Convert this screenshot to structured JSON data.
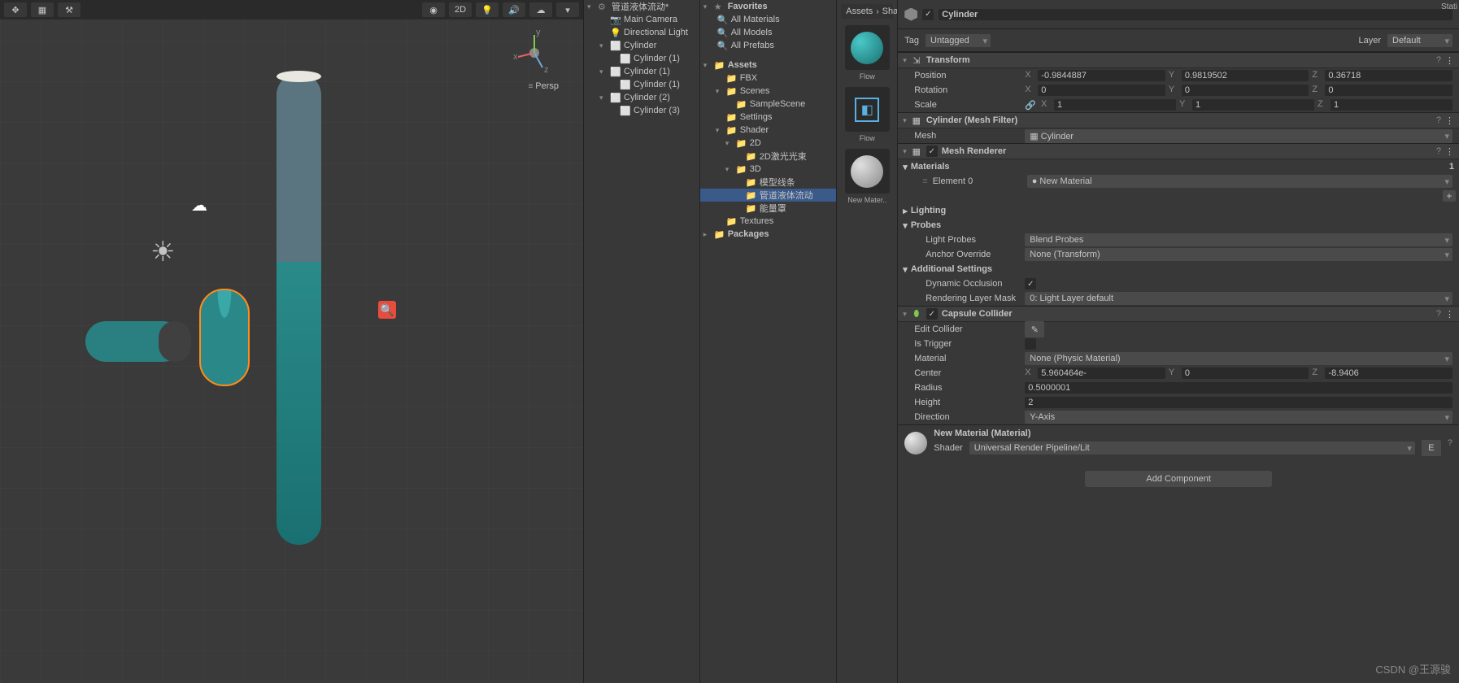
{
  "scene": {
    "persp": "Persp",
    "axes": {
      "x": "x",
      "y": "y",
      "z": "z"
    },
    "toolbar_2d": "2D"
  },
  "hierarchy": {
    "scene_name": "管道液体流动*",
    "items": [
      {
        "name": "Main Camera",
        "indent": 1,
        "icon": "📷"
      },
      {
        "name": "Directional Light",
        "indent": 1,
        "icon": "💡"
      },
      {
        "name": "Cylinder",
        "indent": 1,
        "icon": "⬜",
        "fold": "▾"
      },
      {
        "name": "Cylinder (1)",
        "indent": 2,
        "icon": "⬜"
      },
      {
        "name": "Cylinder (1)",
        "indent": 1,
        "icon": "⬜",
        "fold": "▾"
      },
      {
        "name": "Cylinder (1)",
        "indent": 2,
        "icon": "⬜"
      },
      {
        "name": "Cylinder (2)",
        "indent": 1,
        "icon": "⬜",
        "fold": "▾"
      },
      {
        "name": "Cylinder (3)",
        "indent": 2,
        "icon": "⬜"
      }
    ]
  },
  "project": {
    "breadcrumb": [
      "Assets",
      "Sha"
    ],
    "favorites": "Favorites",
    "fav_items": [
      "All Materials",
      "All Models",
      "All Prefabs"
    ],
    "assets": "Assets",
    "tree": [
      {
        "name": "FBX",
        "indent": 1,
        "icon": "📁"
      },
      {
        "name": "Scenes",
        "indent": 1,
        "icon": "📁",
        "fold": "▾"
      },
      {
        "name": "SampleScene",
        "indent": 2,
        "icon": "📁"
      },
      {
        "name": "Settings",
        "indent": 1,
        "icon": "📁"
      },
      {
        "name": "Shader",
        "indent": 1,
        "icon": "📁",
        "fold": "▾"
      },
      {
        "name": "2D",
        "indent": 2,
        "icon": "📁",
        "fold": "▾"
      },
      {
        "name": "2D激光光束",
        "indent": 3,
        "icon": "📁"
      },
      {
        "name": "3D",
        "indent": 2,
        "icon": "📁",
        "fold": "▾"
      },
      {
        "name": "模型线条",
        "indent": 3,
        "icon": "📁"
      },
      {
        "name": "管道液体流动",
        "indent": 3,
        "icon": "📁",
        "sel": true
      },
      {
        "name": "能量罩",
        "indent": 3,
        "icon": "📁"
      },
      {
        "name": "Textures",
        "indent": 1,
        "icon": "📁"
      }
    ],
    "packages": "Packages"
  },
  "preview": {
    "items": [
      {
        "label": "Flow",
        "type": "sphere"
      },
      {
        "label": "Flow",
        "type": "flow"
      },
      {
        "label": "New Mater..",
        "type": "gray"
      }
    ]
  },
  "inspector": {
    "name": "Cylinder",
    "static_label": "Stati",
    "tag_label": "Tag",
    "tag_value": "Untagged",
    "layer_label": "Layer",
    "layer_value": "Default",
    "transform": {
      "title": "Transform",
      "position": {
        "label": "Position",
        "x": "-0.9844887",
        "y": "0.9819502",
        "z": "0.36718"
      },
      "rotation": {
        "label": "Rotation",
        "x": "0",
        "y": "0",
        "z": "0"
      },
      "scale": {
        "label": "Scale",
        "x": "1",
        "y": "1",
        "z": "1"
      }
    },
    "mesh_filter": {
      "title": "Cylinder (Mesh Filter)",
      "mesh_label": "Mesh",
      "mesh_value": "Cylinder"
    },
    "mesh_renderer": {
      "title": "Mesh Renderer",
      "materials": "Materials",
      "mat_count": "1",
      "element0_label": "Element 0",
      "element0_value": "New Material",
      "lighting": "Lighting",
      "probes": "Probes",
      "light_probes_label": "Light Probes",
      "light_probes_value": "Blend Probes",
      "anchor_label": "Anchor Override",
      "anchor_value": "None (Transform)",
      "additional": "Additional Settings",
      "dyn_occ_label": "Dynamic Occlusion",
      "layer_mask_label": "Rendering Layer Mask",
      "layer_mask_value": "0: Light Layer default"
    },
    "capsule": {
      "title": "Capsule Collider",
      "edit_label": "Edit Collider",
      "trigger_label": "Is Trigger",
      "material_label": "Material",
      "material_value": "None (Physic Material)",
      "center": {
        "label": "Center",
        "x": "5.960464e-",
        "y": "0",
        "z": "-8.9406"
      },
      "radius_label": "Radius",
      "radius_value": "0.5000001",
      "height_label": "Height",
      "height_value": "2",
      "direction_label": "Direction",
      "direction_value": "Y-Axis"
    },
    "material": {
      "title": "New Material (Material)",
      "shader_label": "Shader",
      "shader_value": "Universal Render Pipeline/Lit",
      "edit_btn": "E"
    },
    "add_component": "Add Component"
  },
  "watermark": "CSDN @王源骏"
}
